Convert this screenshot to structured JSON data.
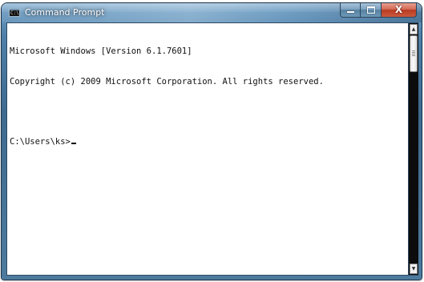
{
  "window": {
    "title": "Command Prompt",
    "icon": "cmd-icon",
    "icon_text": "C:\\"
  },
  "caption_buttons": {
    "minimize_icon": "minimize-icon",
    "maximize_icon": "maximize-icon",
    "close_label": "X"
  },
  "console": {
    "lines": [
      "Microsoft Windows [Version 6.1.7601]",
      "Copyright (c) 2009 Microsoft Corporation. All rights reserved.",
      "",
      "C:\\Users\\ks>"
    ]
  },
  "scrollbar": {
    "up_arrow": "▲",
    "down_arrow": "▼"
  }
}
